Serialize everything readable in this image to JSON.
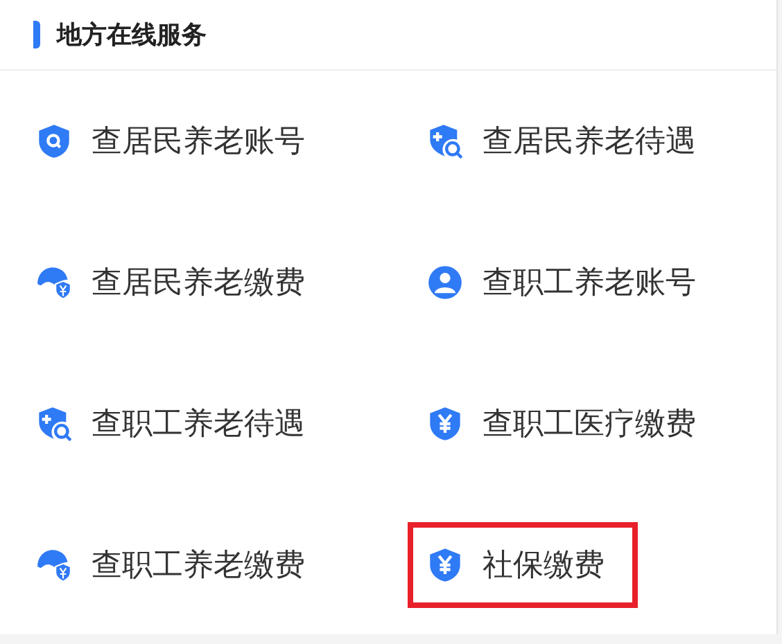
{
  "section": {
    "title": "地方在线服务"
  },
  "services": [
    {
      "label": "查居民养老账号",
      "kind": "search",
      "highlighted": false
    },
    {
      "label": "查居民养老待遇",
      "kind": "plus",
      "highlighted": false
    },
    {
      "label": "查居民养老缴费",
      "kind": "umbrella",
      "highlighted": false
    },
    {
      "label": "查职工养老账号",
      "kind": "person",
      "highlighted": false
    },
    {
      "label": "查职工养老待遇",
      "kind": "plus",
      "highlighted": false
    },
    {
      "label": "查职工医疗缴费",
      "kind": "yen",
      "highlighted": false
    },
    {
      "label": "查职工养老缴费",
      "kind": "umbrella",
      "highlighted": false
    },
    {
      "label": "社保缴费",
      "kind": "yen",
      "highlighted": true
    }
  ]
}
